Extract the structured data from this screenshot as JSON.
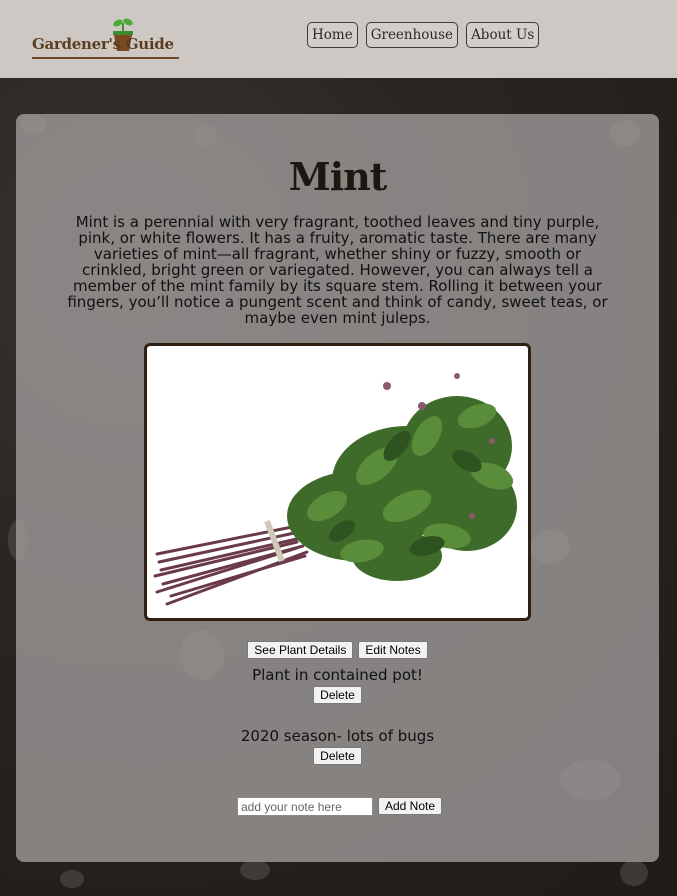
{
  "header": {
    "logo_text": "Gardener's Guide",
    "nav": [
      {
        "label": "Home"
      },
      {
        "label": "Greenhouse"
      },
      {
        "label": "About Us"
      }
    ]
  },
  "plant": {
    "title": "Mint",
    "description": "Mint is a perennial with very fragrant, toothed leaves and tiny purple, pink, or white flowers. It has a fruity, aromatic taste. There are many varieties of mint—all fragrant, whether shiny or fuzzy, smooth or crinkled, bright green or variegated. However, you can always tell a member of the mint family by its square stem. Rolling it between your fingers, you’ll notice a pungent scent and think of candy, sweet teas, or maybe even mint juleps."
  },
  "actions": {
    "details_label": "See Plant Details",
    "edit_label": "Edit Notes"
  },
  "notes": [
    {
      "text": "Plant in contained pot!",
      "delete_label": "Delete"
    },
    {
      "text": "2020 season- lots of bugs",
      "delete_label": "Delete"
    }
  ],
  "add_note": {
    "placeholder": "add your note here",
    "button_label": "Add Note"
  },
  "colors": {
    "header_bg": "#cdc8c4",
    "card_bg": "#a09e9c",
    "title_color": "#1e1710",
    "frame_color": "#2e2012"
  }
}
